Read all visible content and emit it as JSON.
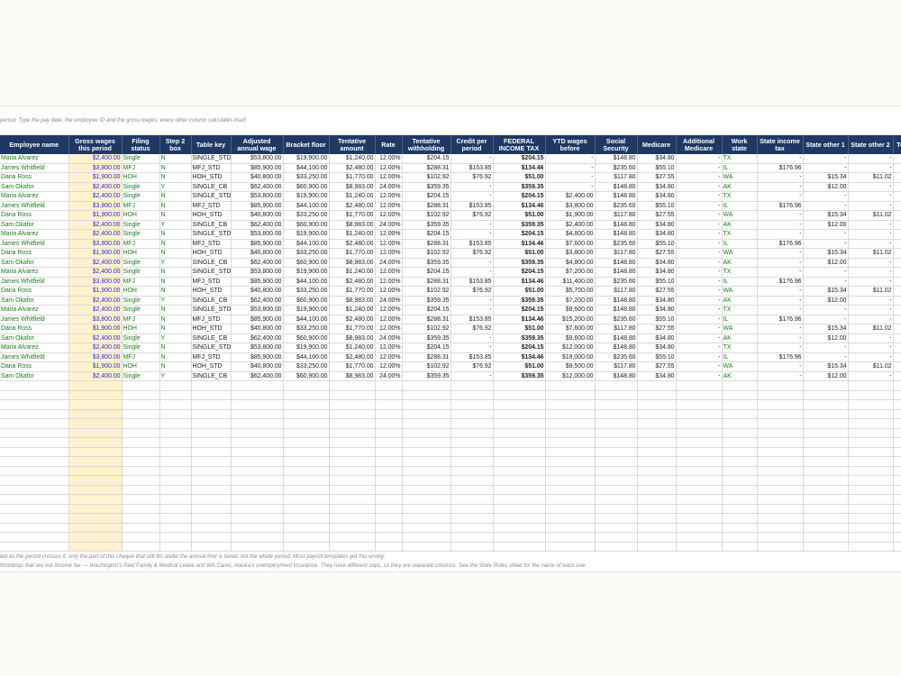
{
  "notes": {
    "top": "period. Type the pay date, the employee ID and the gross wages; every other column calculates itself.",
    "bottom1": "led as the period crosses it: only the part of this cheque that still fits under the annual limit is taxed, not the whole period. Most payroll templates get this wrong.",
    "bottom2": "hholdings that are not income tax — Washington's Paid Family & Medical Leave and WA Cares, Alaska's unemployment insurance. They have different caps, so they are separate columns. See the State Rules sheet for the name of each one."
  },
  "headers": [
    "Employee name",
    "Gross wages this period",
    "Filing status",
    "Step 2 box",
    "Table key",
    "Adjusted annual wage",
    "Bracket floor",
    "Tentative amount",
    "Rate",
    "Tentative withholding",
    "Credit per period",
    "FEDERAL INCOME TAX",
    "YTD wages before",
    "Social Security",
    "Medicare",
    "Additional Medicare",
    "Work state",
    "State income tax",
    "State other 1",
    "State other 2",
    "Tot"
  ],
  "rows": [
    [
      "Maria Alvarez",
      "$2,400.00",
      "Single",
      "N",
      "SINGLE_STD",
      "$53,800.00",
      "$19,900.00",
      "$1,240.00",
      "12.00%",
      "$204.15",
      "-",
      "$204.15",
      "-",
      "$148.80",
      "$34.80",
      "-",
      "TX",
      "-",
      "-",
      "-"
    ],
    [
      "James Whitfield",
      "$3,800.00",
      "MFJ",
      "N",
      "MFJ_STD",
      "$85,900.00",
      "$44,100.00",
      "$2,480.00",
      "12.00%",
      "$288.31",
      "$153.85",
      "$134.46",
      "-",
      "$235.60",
      "$55.10",
      "-",
      "IL",
      "$176.96",
      "-",
      "-"
    ],
    [
      "Dana Ross",
      "$1,900.00",
      "HOH",
      "N",
      "HOH_STD",
      "$40,800.00",
      "$33,250.00",
      "$1,770.00",
      "12.00%",
      "$102.92",
      "$76.92",
      "$51.00",
      "-",
      "$117.80",
      "$27.55",
      "-",
      "WA",
      "-",
      "$15.34",
      "$11.02"
    ],
    [
      "Sam Okafor",
      "$2,400.00",
      "Single",
      "Y",
      "SINGLE_CB",
      "$62,400.00",
      "$60,900.00",
      "$8,983.00",
      "24.00%",
      "$359.35",
      "-",
      "$359.35",
      "-",
      "$148.80",
      "$34.80",
      "-",
      "AK",
      "-",
      "$12.00",
      "-"
    ],
    [
      "Maria Alvarez",
      "$2,400.00",
      "Single",
      "N",
      "SINGLE_STD",
      "$53,800.00",
      "$19,900.00",
      "$1,240.00",
      "12.00%",
      "$204.15",
      "-",
      "$204.15",
      "$2,400.00",
      "$148.80",
      "$34.80",
      "-",
      "TX",
      "-",
      "-",
      "-"
    ],
    [
      "James Whitfield",
      "$3,800.00",
      "MFJ",
      "N",
      "MFJ_STD",
      "$85,900.00",
      "$44,100.00",
      "$2,480.00",
      "12.00%",
      "$288.31",
      "$153.85",
      "$134.46",
      "$3,800.00",
      "$235.60",
      "$55.10",
      "-",
      "IL",
      "$176.96",
      "-",
      "-"
    ],
    [
      "Dana Ross",
      "$1,900.00",
      "HOH",
      "N",
      "HOH_STD",
      "$40,800.00",
      "$33,250.00",
      "$1,770.00",
      "12.00%",
      "$102.92",
      "$76.92",
      "$51.00",
      "$1,900.00",
      "$117.80",
      "$27.55",
      "-",
      "WA",
      "-",
      "$15.34",
      "$11.02"
    ],
    [
      "Sam Okafor",
      "$2,400.00",
      "Single",
      "Y",
      "SINGLE_CB",
      "$62,400.00",
      "$60,900.00",
      "$8,983.00",
      "24.00%",
      "$359.35",
      "-",
      "$359.35",
      "$2,400.00",
      "$148.80",
      "$34.80",
      "-",
      "AK",
      "-",
      "$12.00",
      "-"
    ],
    [
      "Maria Alvarez",
      "$2,400.00",
      "Single",
      "N",
      "SINGLE_STD",
      "$53,800.00",
      "$19,900.00",
      "$1,240.00",
      "12.00%",
      "$204.15",
      "-",
      "$204.15",
      "$4,800.00",
      "$148.80",
      "$34.80",
      "-",
      "TX",
      "-",
      "-",
      "-"
    ],
    [
      "James Whitfield",
      "$3,800.00",
      "MFJ",
      "N",
      "MFJ_STD",
      "$85,900.00",
      "$44,100.00",
      "$2,480.00",
      "12.00%",
      "$288.31",
      "$153.85",
      "$134.46",
      "$7,600.00",
      "$235.60",
      "$55.10",
      "-",
      "IL",
      "$176.96",
      "-",
      "-"
    ],
    [
      "Dana Ross",
      "$1,900.00",
      "HOH",
      "N",
      "HOH_STD",
      "$40,800.00",
      "$33,250.00",
      "$1,770.00",
      "12.00%",
      "$102.92",
      "$76.92",
      "$51.00",
      "$3,800.00",
      "$117.80",
      "$27.55",
      "-",
      "WA",
      "-",
      "$15.34",
      "$11.02"
    ],
    [
      "Sam Okafor",
      "$2,400.00",
      "Single",
      "Y",
      "SINGLE_CB",
      "$62,400.00",
      "$60,900.00",
      "$8,983.00",
      "24.00%",
      "$359.35",
      "-",
      "$359.35",
      "$4,800.00",
      "$148.80",
      "$34.80",
      "-",
      "AK",
      "-",
      "$12.00",
      "-"
    ],
    [
      "Maria Alvarez",
      "$2,400.00",
      "Single",
      "N",
      "SINGLE_STD",
      "$53,800.00",
      "$19,900.00",
      "$1,240.00",
      "12.00%",
      "$204.15",
      "-",
      "$204.15",
      "$7,200.00",
      "$148.80",
      "$34.80",
      "-",
      "TX",
      "-",
      "-",
      "-"
    ],
    [
      "James Whitfield",
      "$3,800.00",
      "MFJ",
      "N",
      "MFJ_STD",
      "$85,900.00",
      "$44,100.00",
      "$2,480.00",
      "12.00%",
      "$288.31",
      "$153.85",
      "$134.46",
      "$11,400.00",
      "$235.60",
      "$55.10",
      "-",
      "IL",
      "$176.96",
      "-",
      "-"
    ],
    [
      "Dana Ross",
      "$1,900.00",
      "HOH",
      "N",
      "HOH_STD",
      "$40,800.00",
      "$33,250.00",
      "$1,770.00",
      "12.00%",
      "$102.92",
      "$76.92",
      "$51.00",
      "$5,700.00",
      "$117.80",
      "$27.55",
      "-",
      "WA",
      "-",
      "$15.34",
      "$11.02"
    ],
    [
      "Sam Okafor",
      "$2,400.00",
      "Single",
      "Y",
      "SINGLE_CB",
      "$62,400.00",
      "$60,900.00",
      "$8,983.00",
      "24.00%",
      "$359.35",
      "-",
      "$359.35",
      "$7,200.00",
      "$148.80",
      "$34.80",
      "-",
      "AK",
      "-",
      "$12.00",
      "-"
    ],
    [
      "Maria Alvarez",
      "$2,400.00",
      "Single",
      "N",
      "SINGLE_STD",
      "$53,800.00",
      "$19,900.00",
      "$1,240.00",
      "12.00%",
      "$204.15",
      "-",
      "$204.15",
      "$9,600.00",
      "$148.80",
      "$34.80",
      "-",
      "TX",
      "-",
      "-",
      "-"
    ],
    [
      "James Whitfield",
      "$3,800.00",
      "MFJ",
      "N",
      "MFJ_STD",
      "$85,900.00",
      "$44,100.00",
      "$2,480.00",
      "12.00%",
      "$288.31",
      "$153.85",
      "$134.46",
      "$15,200.00",
      "$235.60",
      "$55.10",
      "-",
      "IL",
      "$176.96",
      "-",
      "-"
    ],
    [
      "Dana Ross",
      "$1,900.00",
      "HOH",
      "N",
      "HOH_STD",
      "$40,800.00",
      "$33,250.00",
      "$1,770.00",
      "12.00%",
      "$102.92",
      "$76.92",
      "$51.00",
      "$7,600.00",
      "$117.80",
      "$27.55",
      "-",
      "WA",
      "-",
      "$15.34",
      "$11.02"
    ],
    [
      "Sam Okafor",
      "$2,400.00",
      "Single",
      "Y",
      "SINGLE_CB",
      "$62,400.00",
      "$60,900.00",
      "$8,983.00",
      "24.00%",
      "$359.35",
      "-",
      "$359.35",
      "$9,600.00",
      "$148.80",
      "$34.80",
      "-",
      "AK",
      "-",
      "$12.00",
      "-"
    ],
    [
      "Maria Alvarez",
      "$2,400.00",
      "Single",
      "N",
      "SINGLE_STD",
      "$53,800.00",
      "$19,900.00",
      "$1,240.00",
      "12.00%",
      "$204.15",
      "-",
      "$204.15",
      "$12,000.00",
      "$148.80",
      "$34.80",
      "-",
      "TX",
      "-",
      "-",
      "-"
    ],
    [
      "James Whitfield",
      "$3,800.00",
      "MFJ",
      "N",
      "MFJ_STD",
      "$85,900.00",
      "$44,100.00",
      "$2,480.00",
      "12.00%",
      "$288.31",
      "$153.85",
      "$134.46",
      "$19,000.00",
      "$235.60",
      "$55.10",
      "-",
      "IL",
      "$176.96",
      "-",
      "-"
    ],
    [
      "Dana Ross",
      "$1,900.00",
      "HOH",
      "N",
      "HOH_STD",
      "$40,800.00",
      "$33,250.00",
      "$1,770.00",
      "12.00%",
      "$102.92",
      "$76.92",
      "$51.00",
      "$9,500.00",
      "$117.80",
      "$27.55",
      "-",
      "WA",
      "-",
      "$15.34",
      "$11.02"
    ],
    [
      "Sam Okafor",
      "$2,400.00",
      "Single",
      "Y",
      "SINGLE_CB",
      "$62,400.00",
      "$60,900.00",
      "$8,983.00",
      "24.00%",
      "$359.35",
      "-",
      "$359.35",
      "$12,000.00",
      "$148.80",
      "$34.80",
      "-",
      "AK",
      "-",
      "$12.00",
      "-"
    ]
  ],
  "colors": {
    "header_bg": "#1f3864",
    "input_bg": "#fff3cf",
    "input_text": "#2a2ad0",
    "name_text": "#1e7b1e"
  }
}
